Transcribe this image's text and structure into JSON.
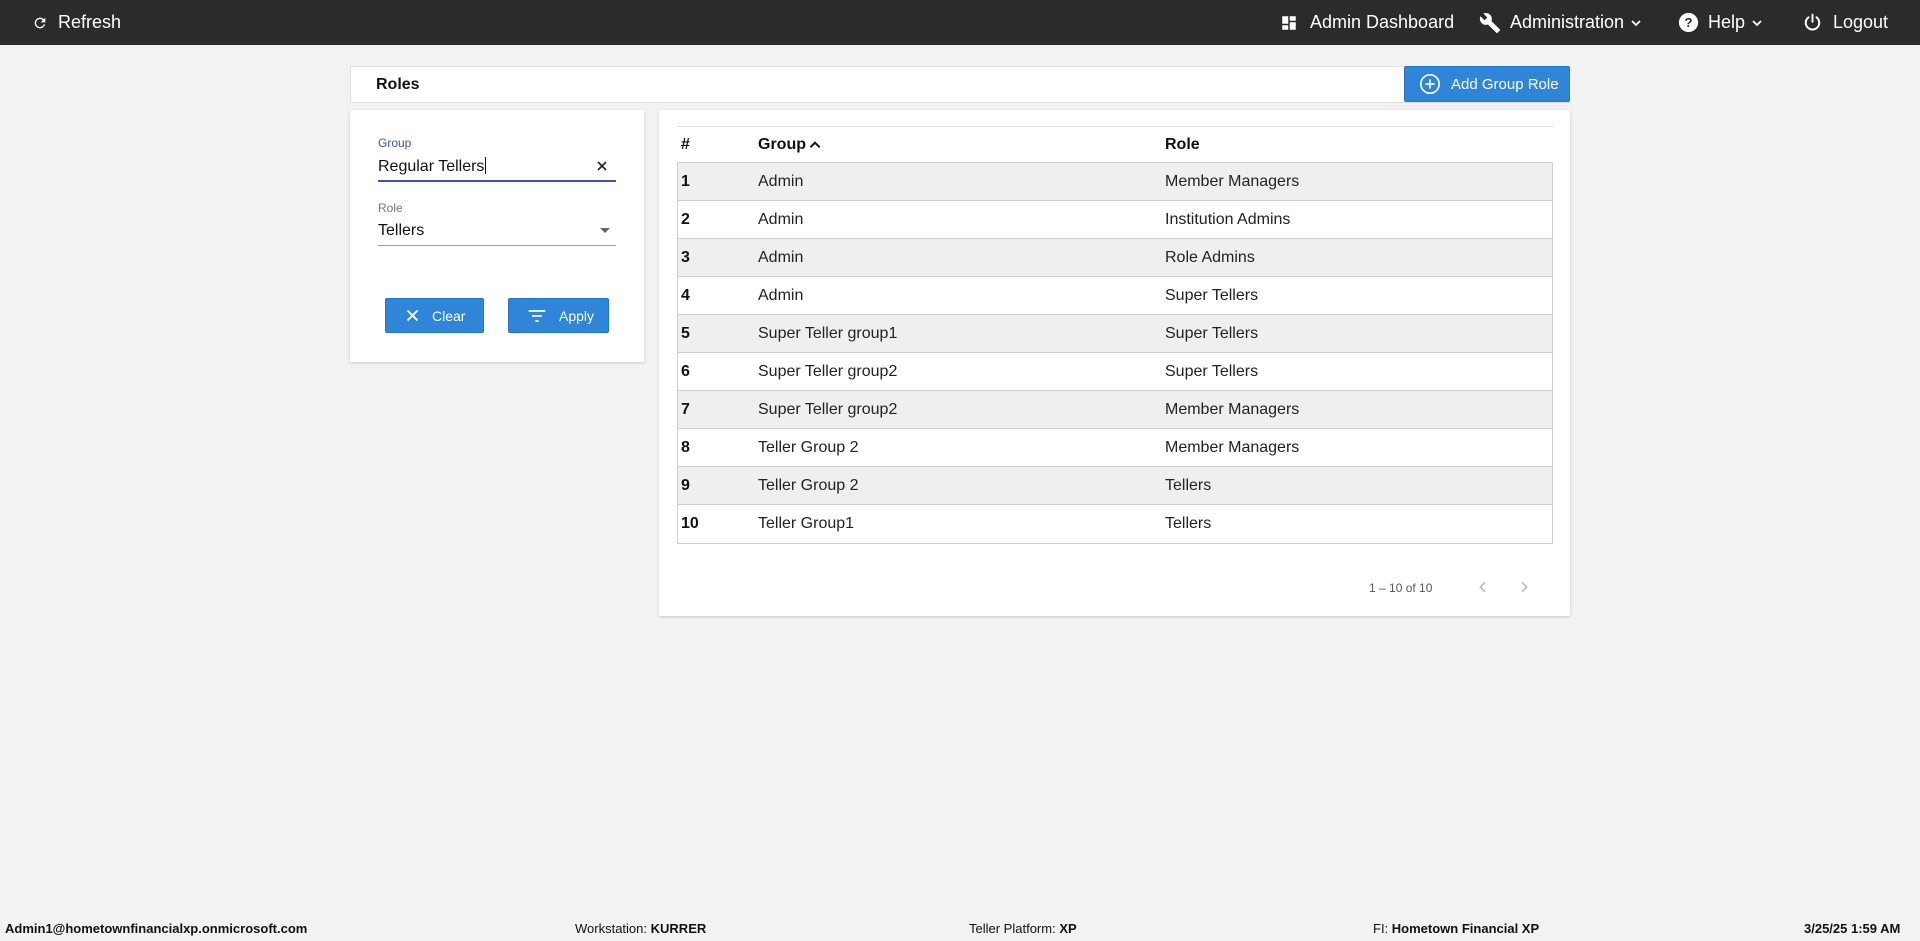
{
  "topbar": {
    "refresh_label": "Refresh",
    "dashboard_label": "Admin Dashboard",
    "administration_label": "Administration",
    "help_label": "Help",
    "logout_label": "Logout"
  },
  "page": {
    "title": "Roles",
    "add_button_label": "Add Group Role"
  },
  "filters": {
    "group_label": "Group",
    "group_value": "Regular Tellers",
    "role_label": "Role",
    "role_value": "Tellers",
    "clear_label": "Clear",
    "apply_label": "Apply"
  },
  "table": {
    "columns": [
      "#",
      "Group",
      "Role"
    ],
    "rows": [
      {
        "num": "1",
        "group": "Admin",
        "role": "Member Managers"
      },
      {
        "num": "2",
        "group": "Admin",
        "role": "Institution Admins"
      },
      {
        "num": "3",
        "group": "Admin",
        "role": "Role Admins"
      },
      {
        "num": "4",
        "group": "Admin",
        "role": "Super Tellers"
      },
      {
        "num": "5",
        "group": "Super Teller group1",
        "role": "Super Tellers"
      },
      {
        "num": "6",
        "group": "Super Teller group2",
        "role": "Super Tellers"
      },
      {
        "num": "7",
        "group": "Super Teller group2",
        "role": "Member Managers"
      },
      {
        "num": "8",
        "group": "Teller Group 2",
        "role": "Member Managers"
      },
      {
        "num": "9",
        "group": "Teller Group 2",
        "role": "Tellers"
      },
      {
        "num": "10",
        "group": "Teller Group1",
        "role": "Tellers"
      }
    ],
    "pagination": "1 – 10 of 10"
  },
  "status": {
    "user": "Admin1@hometownfinancialxp.onmicrosoft.com",
    "workstation_label": "Workstation:",
    "workstation": "KURRER",
    "platform_label": "Teller Platform:",
    "platform": "XP",
    "fi_label": "FI:",
    "fi": "Hometown Financial XP",
    "datetime": "3/25/25 1:59 AM"
  },
  "colors": {
    "topbar": "#2b2b2b",
    "primary_button": "#2f86d8",
    "focus_underline": "#3f51b5"
  },
  "icons": {
    "refresh": "refresh-icon",
    "dashboard": "dashboard-icon",
    "administration": "wrench-icon",
    "help": "help-circle-icon",
    "logout": "power-icon",
    "add": "plus-circle-icon",
    "clear": "close-icon",
    "apply": "filter-icon",
    "sort": "sort-asc-icon"
  }
}
